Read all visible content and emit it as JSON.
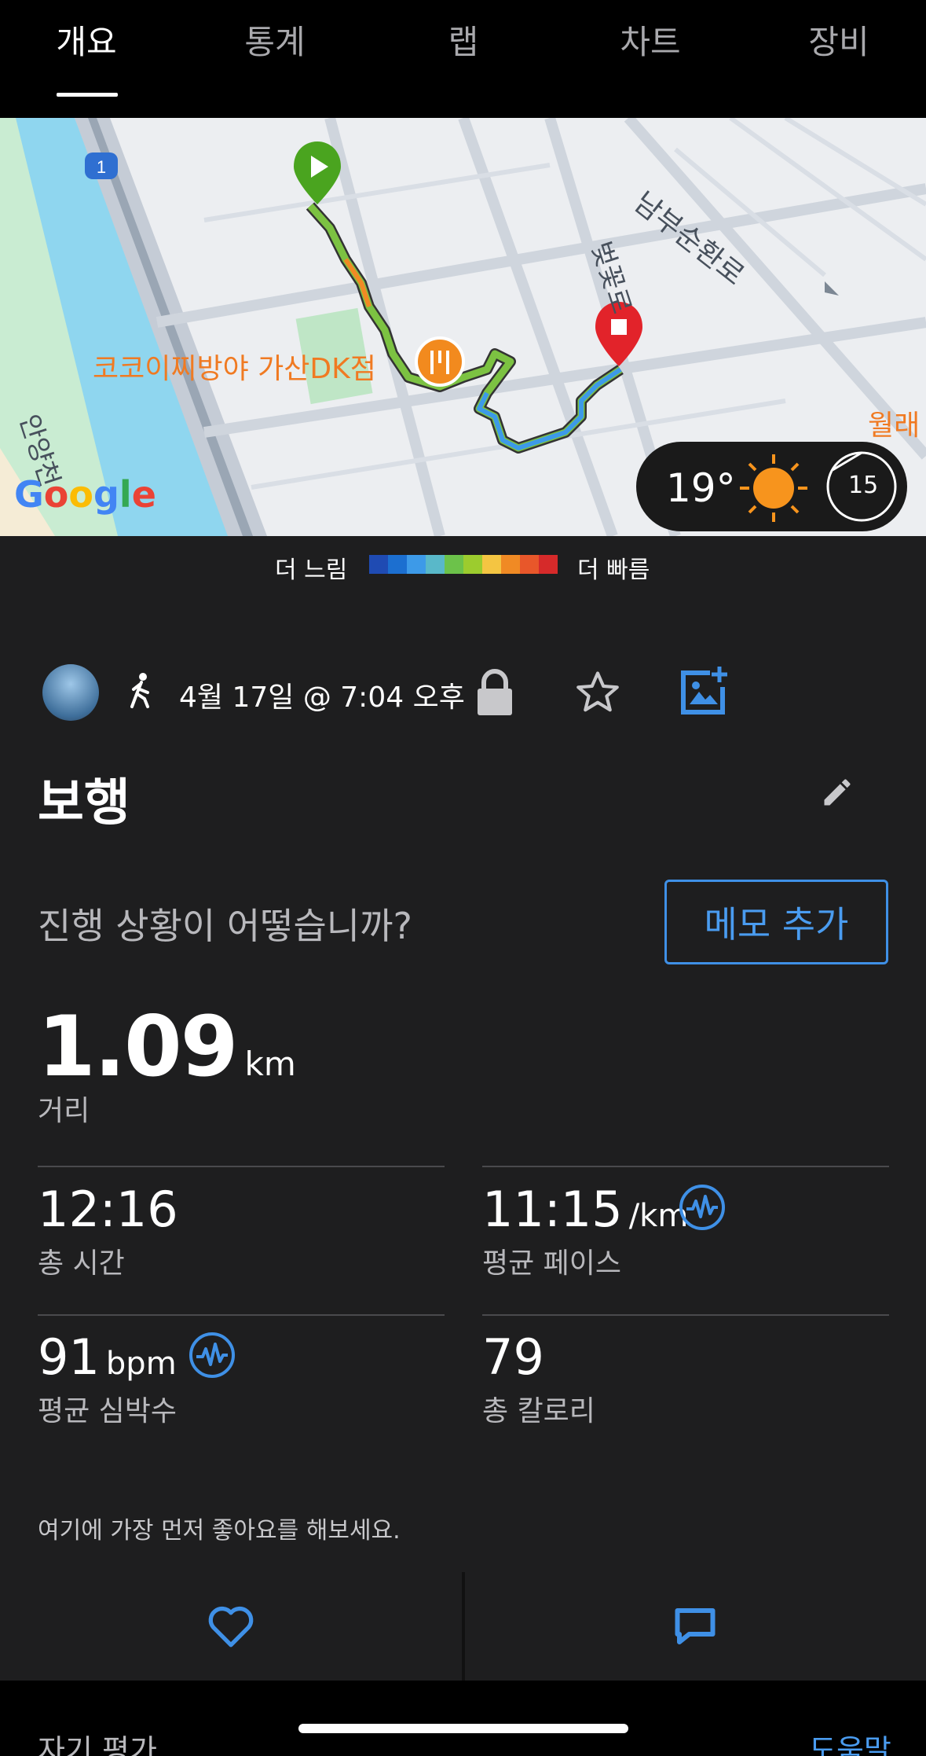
{
  "tabs": [
    {
      "label": "개요",
      "active": true
    },
    {
      "label": "통계",
      "active": false
    },
    {
      "label": "랩",
      "active": false
    },
    {
      "label": "차트",
      "active": false
    },
    {
      "label": "장비",
      "active": false
    }
  ],
  "map": {
    "poi_label": "코코이찌방야 가산DK점",
    "street_labels": [
      "남부순환로",
      "벚꽃로",
      "월래",
      "안양천"
    ],
    "road_shield": "1",
    "weather": {
      "temperature": "19°",
      "wind": "15",
      "icon": "sun-icon"
    }
  },
  "legend": {
    "slow_label": "더 느림",
    "fast_label": "더 빠름",
    "colors": [
      "#1f4bb3",
      "#1c6fd0",
      "#3d9ae8",
      "#59b8c9",
      "#6cc24a",
      "#9ccc2e",
      "#f4c542",
      "#f08a24",
      "#e8572a",
      "#d62a2a"
    ]
  },
  "activity": {
    "date": "4월 17일 @ 7:04 오후",
    "title": "보행",
    "question": "진행 상황이 어떻습니까?",
    "memo_button": "메모 추가"
  },
  "stats": {
    "distance": {
      "value": "1.09",
      "unit": "km",
      "label": "거리"
    },
    "total_time": {
      "value": "12:16",
      "label": "총 시간"
    },
    "avg_pace": {
      "value": "11:15",
      "unit": "/km",
      "label": "평균 페이스"
    },
    "avg_hr": {
      "value": "91",
      "unit": "bpm",
      "label": "평균 심박수"
    },
    "calories": {
      "value": "79",
      "label": "총 칼로리"
    }
  },
  "social": {
    "like_prompt": "여기에 가장 먼저 좋아요를 해보세요."
  },
  "footer": {
    "self_eval": "자기 평가",
    "help": "도움말"
  },
  "colors": {
    "accent": "#4a9cf0",
    "background": "#1e1e1f"
  }
}
